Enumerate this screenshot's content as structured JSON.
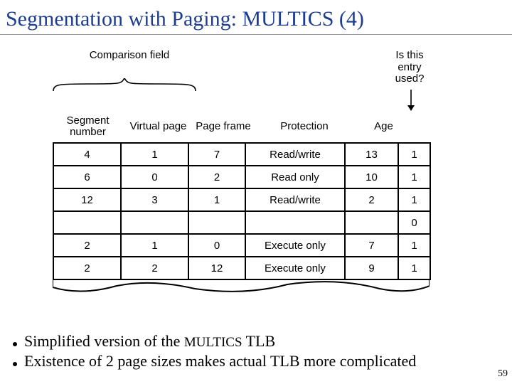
{
  "title": "Segmentation with Paging: MULTICS (4)",
  "annotations": {
    "comparison_field": "Comparison field",
    "is_this_entry_used": "Is this entry used?"
  },
  "headers": {
    "segment_number": "Segment number",
    "virtual_page": "Virtual page",
    "page_frame": "Page frame",
    "protection": "Protection",
    "age": "Age"
  },
  "rows": [
    {
      "seg": "4",
      "vpage": "1",
      "frame": "7",
      "prot": "Read/write",
      "age": "13",
      "used": "1"
    },
    {
      "seg": "6",
      "vpage": "0",
      "frame": "2",
      "prot": "Read only",
      "age": "10",
      "used": "1"
    },
    {
      "seg": "12",
      "vpage": "3",
      "frame": "1",
      "prot": "Read/write",
      "age": "2",
      "used": "1"
    },
    {
      "seg": "",
      "vpage": "",
      "frame": "",
      "prot": "",
      "age": "",
      "used": "0"
    },
    {
      "seg": "2",
      "vpage": "1",
      "frame": "0",
      "prot": "Execute only",
      "age": "7",
      "used": "1"
    },
    {
      "seg": "2",
      "vpage": "2",
      "frame": "12",
      "prot": "Execute only",
      "age": "9",
      "used": "1"
    }
  ],
  "bullets": {
    "b1_prefix": "Simplified version of the ",
    "b1_sc": "MULTICS",
    "b1_suffix": " TLB",
    "b2": "Existence of 2 page sizes makes actual TLB more complicated"
  },
  "page_number": "59",
  "chart_data": {
    "type": "table",
    "title": "Simplified MULTICS TLB",
    "columns": [
      "Segment number",
      "Virtual page",
      "Page frame",
      "Protection",
      "Age",
      "Is this entry used?"
    ],
    "rows": [
      [
        "4",
        "1",
        "7",
        "Read/write",
        "13",
        "1"
      ],
      [
        "6",
        "0",
        "2",
        "Read only",
        "10",
        "1"
      ],
      [
        "12",
        "3",
        "1",
        "Read/write",
        "2",
        "1"
      ],
      [
        "",
        "",
        "",
        "",
        "",
        "0"
      ],
      [
        "2",
        "1",
        "0",
        "Execute only",
        "7",
        "1"
      ],
      [
        "2",
        "2",
        "12",
        "Execute only",
        "9",
        "1"
      ]
    ]
  }
}
